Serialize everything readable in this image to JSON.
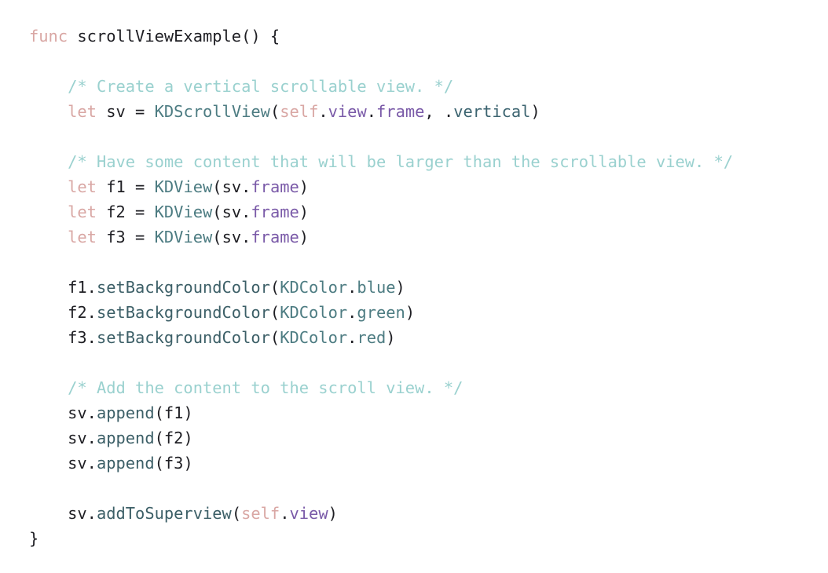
{
  "colors": {
    "keyword": "#d9a7a4",
    "plain": "#1f1f24",
    "comment": "#9ad1cf",
    "type": "#4d7c82",
    "property": "#7a5aa8",
    "method": "#3c5f67",
    "enum_case": "#3c6470"
  },
  "code": {
    "lines": [
      [
        [
          "keyword",
          "func"
        ],
        [
          "plain",
          " scrollViewExample() {"
        ]
      ],
      [],
      [
        [
          "plain",
          "    "
        ],
        [
          "comment",
          "/* Create a vertical scrollable view. */"
        ]
      ],
      [
        [
          "plain",
          "    "
        ],
        [
          "keyword",
          "let"
        ],
        [
          "plain",
          " sv = "
        ],
        [
          "type",
          "KDScrollView"
        ],
        [
          "plain",
          "("
        ],
        [
          "keyword",
          "self"
        ],
        [
          "plain",
          "."
        ],
        [
          "property",
          "view"
        ],
        [
          "plain",
          "."
        ],
        [
          "property",
          "frame"
        ],
        [
          "plain",
          ", ."
        ],
        [
          "enum_case",
          "vertical"
        ],
        [
          "plain",
          ")"
        ]
      ],
      [],
      [
        [
          "plain",
          "    "
        ],
        [
          "comment",
          "/* Have some content that will be larger than the scrollable view. */"
        ]
      ],
      [
        [
          "plain",
          "    "
        ],
        [
          "keyword",
          "let"
        ],
        [
          "plain",
          " f1 = "
        ],
        [
          "type",
          "KDView"
        ],
        [
          "plain",
          "(sv."
        ],
        [
          "property",
          "frame"
        ],
        [
          "plain",
          ")"
        ]
      ],
      [
        [
          "plain",
          "    "
        ],
        [
          "keyword",
          "let"
        ],
        [
          "plain",
          " f2 = "
        ],
        [
          "type",
          "KDView"
        ],
        [
          "plain",
          "(sv."
        ],
        [
          "property",
          "frame"
        ],
        [
          "plain",
          ")"
        ]
      ],
      [
        [
          "plain",
          "    "
        ],
        [
          "keyword",
          "let"
        ],
        [
          "plain",
          " f3 = "
        ],
        [
          "type",
          "KDView"
        ],
        [
          "plain",
          "(sv."
        ],
        [
          "property",
          "frame"
        ],
        [
          "plain",
          ")"
        ]
      ],
      [],
      [
        [
          "plain",
          "    f1."
        ],
        [
          "method",
          "setBackgroundColor"
        ],
        [
          "plain",
          "("
        ],
        [
          "type",
          "KDColor"
        ],
        [
          "plain",
          "."
        ],
        [
          "type",
          "blue"
        ],
        [
          "plain",
          ")"
        ]
      ],
      [
        [
          "plain",
          "    f2."
        ],
        [
          "method",
          "setBackgroundColor"
        ],
        [
          "plain",
          "("
        ],
        [
          "type",
          "KDColor"
        ],
        [
          "plain",
          "."
        ],
        [
          "type",
          "green"
        ],
        [
          "plain",
          ")"
        ]
      ],
      [
        [
          "plain",
          "    f3."
        ],
        [
          "method",
          "setBackgroundColor"
        ],
        [
          "plain",
          "("
        ],
        [
          "type",
          "KDColor"
        ],
        [
          "plain",
          "."
        ],
        [
          "type",
          "red"
        ],
        [
          "plain",
          ")"
        ]
      ],
      [],
      [
        [
          "plain",
          "    "
        ],
        [
          "comment",
          "/* Add the content to the scroll view. */"
        ]
      ],
      [
        [
          "plain",
          "    sv."
        ],
        [
          "method",
          "append"
        ],
        [
          "plain",
          "(f1)"
        ]
      ],
      [
        [
          "plain",
          "    sv."
        ],
        [
          "method",
          "append"
        ],
        [
          "plain",
          "(f2)"
        ]
      ],
      [
        [
          "plain",
          "    sv."
        ],
        [
          "method",
          "append"
        ],
        [
          "plain",
          "(f3)"
        ]
      ],
      [],
      [
        [
          "plain",
          "    sv."
        ],
        [
          "method",
          "addToSuperview"
        ],
        [
          "plain",
          "("
        ],
        [
          "keyword",
          "self"
        ],
        [
          "plain",
          "."
        ],
        [
          "property",
          "view"
        ],
        [
          "plain",
          ")"
        ]
      ],
      [
        [
          "plain",
          "}"
        ]
      ]
    ]
  }
}
